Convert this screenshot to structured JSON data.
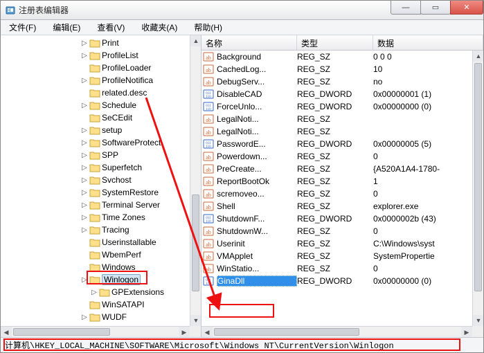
{
  "window": {
    "title": "注册表编辑器"
  },
  "menu": {
    "file": "文件(F)",
    "edit": "编辑(E)",
    "view": "查看(V)",
    "favorites": "收藏夹(A)",
    "help": "帮助(H)"
  },
  "columns": {
    "name": "名称",
    "type": "类型",
    "data": "数据"
  },
  "tree": {
    "items": [
      {
        "label": "Print",
        "expandable": true,
        "level": 0
      },
      {
        "label": "ProfileList",
        "expandable": true,
        "level": 0
      },
      {
        "label": "ProfileLoader",
        "expandable": false,
        "level": 0
      },
      {
        "label": "ProfileNotifica",
        "expandable": true,
        "level": 0
      },
      {
        "label": "related.desc",
        "expandable": false,
        "level": 0
      },
      {
        "label": "Schedule",
        "expandable": true,
        "level": 0
      },
      {
        "label": "SeCEdit",
        "expandable": false,
        "level": 0
      },
      {
        "label": "setup",
        "expandable": true,
        "level": 0
      },
      {
        "label": "SoftwareProtect",
        "expandable": true,
        "level": 0
      },
      {
        "label": "SPP",
        "expandable": true,
        "level": 0
      },
      {
        "label": "Superfetch",
        "expandable": true,
        "level": 0
      },
      {
        "label": "Svchost",
        "expandable": true,
        "level": 0
      },
      {
        "label": "SystemRestore",
        "expandable": true,
        "level": 0
      },
      {
        "label": "Terminal Server",
        "expandable": true,
        "level": 0
      },
      {
        "label": "Time Zones",
        "expandable": true,
        "level": 0
      },
      {
        "label": "Tracing",
        "expandable": true,
        "level": 0
      },
      {
        "label": "Userinstallable",
        "expandable": false,
        "level": 0
      },
      {
        "label": "WbemPerf",
        "expandable": false,
        "level": 0
      },
      {
        "label": "Windows",
        "expandable": false,
        "level": 0
      },
      {
        "label": "Winlogon",
        "expandable": true,
        "level": 0,
        "selected": true
      },
      {
        "label": "GPExtensions",
        "expandable": true,
        "level": 1
      },
      {
        "label": "WinSATAPI",
        "expandable": false,
        "level": 0
      },
      {
        "label": "WUDF",
        "expandable": true,
        "level": 0
      }
    ]
  },
  "values": [
    {
      "name": "Background",
      "type": "REG_SZ",
      "data": "0 0 0",
      "icon": "sz"
    },
    {
      "name": "CachedLog...",
      "type": "REG_SZ",
      "data": "10",
      "icon": "sz"
    },
    {
      "name": "DebugServ...",
      "type": "REG_SZ",
      "data": "no",
      "icon": "sz"
    },
    {
      "name": "DisableCAD",
      "type": "REG_DWORD",
      "data": "0x00000001 (1)",
      "icon": "dw"
    },
    {
      "name": "ForceUnlo...",
      "type": "REG_DWORD",
      "data": "0x00000000 (0)",
      "icon": "dw"
    },
    {
      "name": "LegalNoti...",
      "type": "REG_SZ",
      "data": "",
      "icon": "sz"
    },
    {
      "name": "LegalNoti...",
      "type": "REG_SZ",
      "data": "",
      "icon": "sz"
    },
    {
      "name": "PasswordE...",
      "type": "REG_DWORD",
      "data": "0x00000005 (5)",
      "icon": "dw"
    },
    {
      "name": "Powerdown...",
      "type": "REG_SZ",
      "data": "0",
      "icon": "sz"
    },
    {
      "name": "PreCreate...",
      "type": "REG_SZ",
      "data": "{A520A1A4-1780-",
      "icon": "sz"
    },
    {
      "name": "ReportBootOk",
      "type": "REG_SZ",
      "data": "1",
      "icon": "sz"
    },
    {
      "name": "scremoveo...",
      "type": "REG_SZ",
      "data": "0",
      "icon": "sz"
    },
    {
      "name": "Shell",
      "type": "REG_SZ",
      "data": "explorer.exe",
      "icon": "sz"
    },
    {
      "name": "ShutdownF...",
      "type": "REG_DWORD",
      "data": "0x0000002b (43)",
      "icon": "dw"
    },
    {
      "name": "ShutdownW...",
      "type": "REG_SZ",
      "data": "0",
      "icon": "sz"
    },
    {
      "name": "Userinit",
      "type": "REG_SZ",
      "data": "C:\\Windows\\syst",
      "icon": "sz"
    },
    {
      "name": "VMApplet",
      "type": "REG_SZ",
      "data": "SystemPropertie",
      "icon": "sz"
    },
    {
      "name": "WinStatio...",
      "type": "REG_SZ",
      "data": "0",
      "icon": "sz"
    },
    {
      "name": "GinaDll",
      "type": "REG_DWORD",
      "data": "0x00000000 (0)",
      "icon": "dw",
      "selected": true
    }
  ],
  "statusbar": {
    "path": "计算机\\HKEY_LOCAL_MACHINE\\SOFTWARE\\Microsoft\\Windows NT\\CurrentVersion\\Winlogon"
  },
  "winbtn": {
    "min": "—",
    "max": "▭",
    "close": "✕"
  }
}
